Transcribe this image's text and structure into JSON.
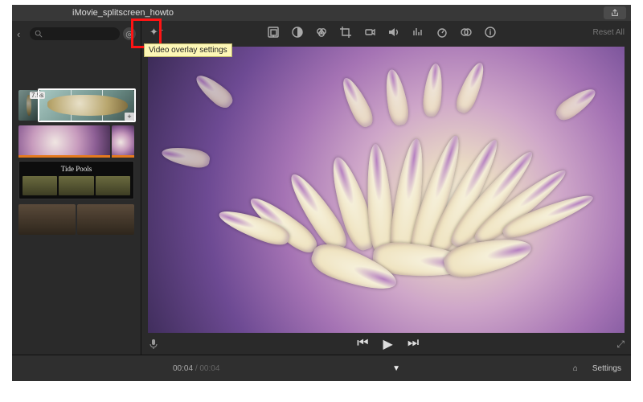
{
  "titlebar": {
    "project": "iMovie_splitscreen_howto"
  },
  "sidebar": {
    "selected_duration": "7.5s",
    "title_card": "Tide Pools"
  },
  "toolbar": {
    "icons": [
      "video-overlay-settings",
      "color-balance",
      "color-correction",
      "crop",
      "stabilization",
      "volume",
      "noise-reduction-eq",
      "speed",
      "clip-filter-audio-effects",
      "info"
    ],
    "tooltip": "Video overlay settings",
    "reset": "Reset All",
    "highlighted_icon": "video-overlay-settings"
  },
  "playback": {
    "controls": [
      "previous",
      "play",
      "next"
    ]
  },
  "footer": {
    "current": "00:04",
    "total": "00:04",
    "settings": "Settings"
  }
}
